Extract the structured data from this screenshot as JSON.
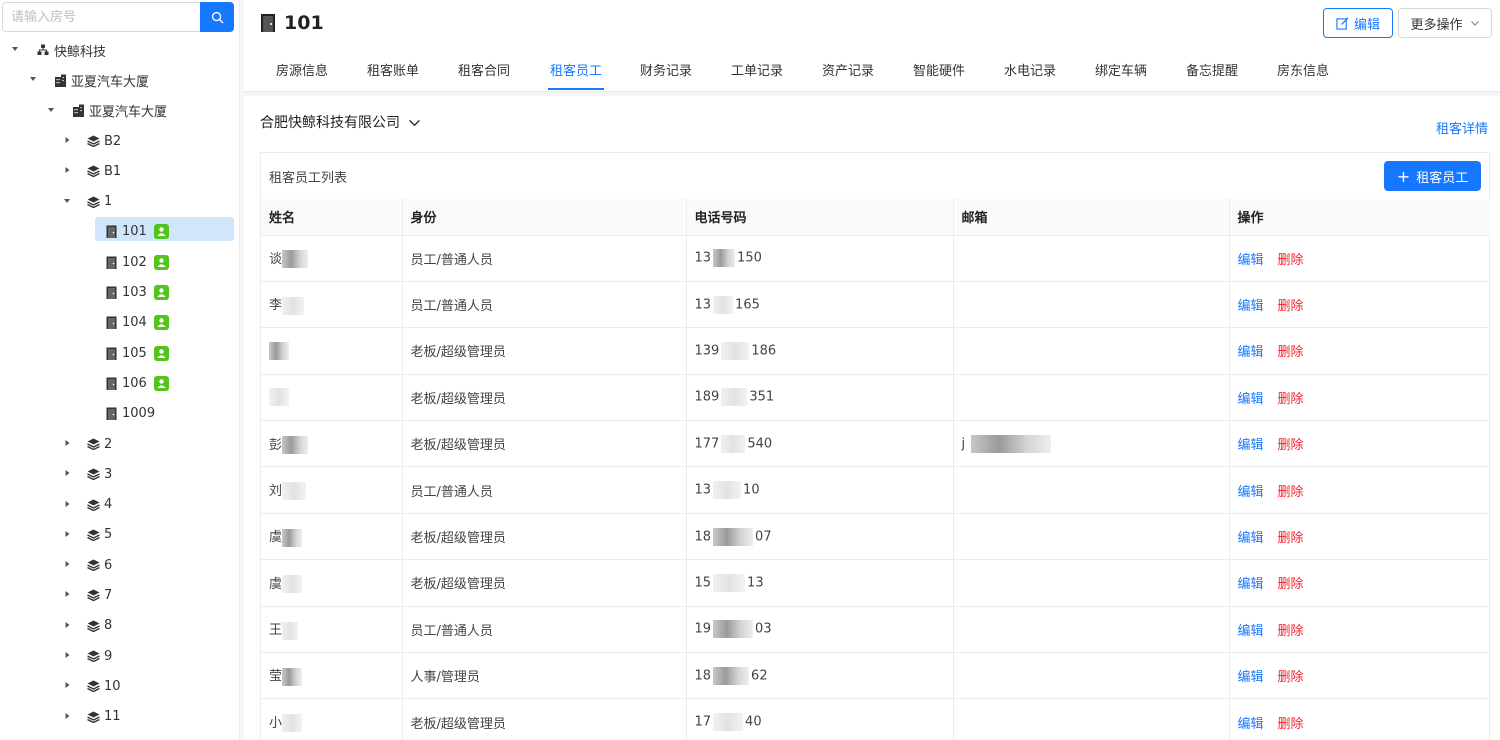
{
  "search": {
    "placeholder": "请输入房号"
  },
  "tree": {
    "org": "快鲸科技",
    "building": "亚夏汽车大厦",
    "sub_building": "亚夏汽车大厦",
    "floors_top": [
      "B2",
      "B1"
    ],
    "floor_open": "1",
    "rooms": [
      {
        "label": "101",
        "occupied": true,
        "selected": true
      },
      {
        "label": "102",
        "occupied": true
      },
      {
        "label": "103",
        "occupied": true
      },
      {
        "label": "104",
        "occupied": true
      },
      {
        "label": "105",
        "occupied": true
      },
      {
        "label": "106",
        "occupied": true
      },
      {
        "label": "1009",
        "occupied": false
      }
    ],
    "floors_bottom": [
      "2",
      "3",
      "4",
      "5",
      "6",
      "7",
      "8",
      "9",
      "10",
      "11"
    ]
  },
  "header": {
    "room_title": "101",
    "edit_label": "编辑",
    "more_label": "更多操作"
  },
  "tabs": [
    "房源信息",
    "租客账单",
    "租客合同",
    "租客员工",
    "财务记录",
    "工单记录",
    "资产记录",
    "智能硬件",
    "水电记录",
    "绑定车辆",
    "备忘提醒",
    "房东信息"
  ],
  "active_tab": "租客员工",
  "panel": {
    "company": "合肥快鲸科技有限公司",
    "tenant_detail": "租客详情",
    "list_title": "租客员工列表",
    "add_label": "租客员工"
  },
  "table": {
    "columns": [
      "姓名",
      "身份",
      "电话号码",
      "邮箱",
      "操作"
    ],
    "edit_label": "编辑",
    "delete_label": "删除",
    "rows": [
      {
        "name": "谈",
        "role": "员工/普通人员",
        "phone_prefix": "13",
        "phone_suffix": "150",
        "email": ""
      },
      {
        "name": "李",
        "role": "员工/普通人员",
        "phone_prefix": "13",
        "phone_suffix": "165",
        "email": ""
      },
      {
        "name": "",
        "role": "老板/超级管理员",
        "phone_prefix": "139",
        "phone_suffix": "186",
        "email": ""
      },
      {
        "name": "",
        "role": "老板/超级管理员",
        "phone_prefix": "189",
        "phone_suffix": "351",
        "email": ""
      },
      {
        "name": "彭",
        "role": "老板/超级管理员",
        "phone_prefix": "177",
        "phone_suffix": "540",
        "email": "j"
      },
      {
        "name": "刘",
        "role": "员工/普通人员",
        "phone_prefix": "13",
        "phone_suffix": "10",
        "email": ""
      },
      {
        "name": "虞",
        "role": "老板/超级管理员",
        "phone_prefix": "18",
        "phone_suffix": "07",
        "email": ""
      },
      {
        "name": "虞",
        "role": "老板/超级管理员",
        "phone_prefix": "15",
        "phone_suffix": "13",
        "email": ""
      },
      {
        "name": "王",
        "role": "员工/普通人员",
        "phone_prefix": "19",
        "phone_suffix": "03",
        "email": ""
      },
      {
        "name": "莹",
        "role": "人事/管理员",
        "phone_prefix": "18",
        "phone_suffix": "62",
        "email": ""
      },
      {
        "name": "小",
        "role": "老板/超级管理员",
        "phone_prefix": "17",
        "phone_suffix": "40",
        "email": ""
      }
    ]
  },
  "colors": {
    "accent": "#1677ff",
    "danger": "#f5222d",
    "occupied": "#52c41a",
    "selected_bg": "#cfe6fb"
  }
}
